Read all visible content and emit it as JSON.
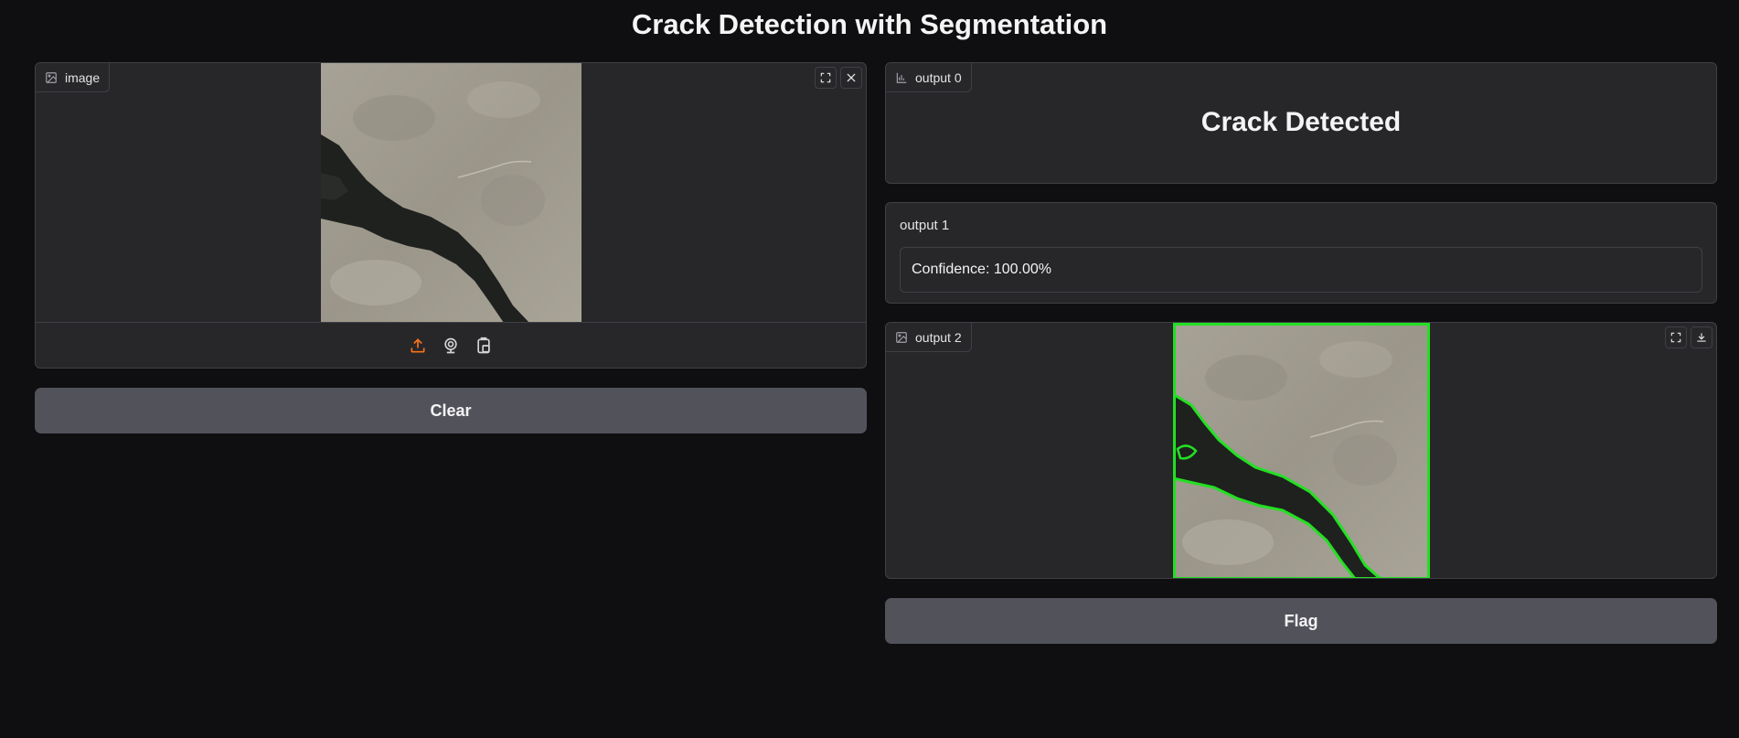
{
  "title": "Crack Detection with Segmentation",
  "input_panel": {
    "label": "image",
    "icons": [
      "image-icon",
      "fullscreen-icon",
      "close-icon",
      "upload-icon",
      "webcam-icon",
      "clipboard-icon"
    ]
  },
  "clear_button": "Clear",
  "output0": {
    "label": "output 0",
    "heading": "Crack Detected"
  },
  "output1": {
    "label": "output 1",
    "value": "Confidence: 100.00%"
  },
  "output2": {
    "label": "output 2"
  },
  "flag_button": "Flag",
  "colors": {
    "background": "#0f0f11",
    "panel": "#27272a",
    "border": "#3f3f46",
    "button": "#52525b",
    "accent": "#f97316",
    "segmentation": "#22e022"
  }
}
